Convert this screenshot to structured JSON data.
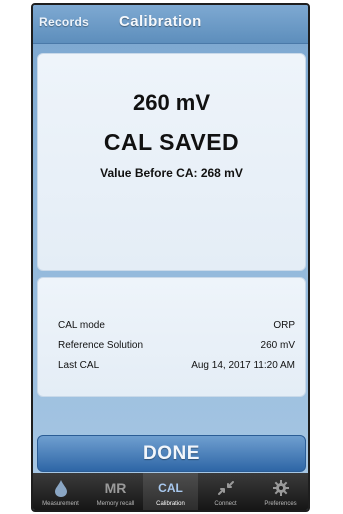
{
  "header": {
    "back_label": "Records",
    "title": "Calibration"
  },
  "result": {
    "value": "260 mV",
    "status": "CAL SAVED",
    "before": "Value Before CA: 268 mV"
  },
  "info": {
    "rows": [
      {
        "key": "CAL mode",
        "value": "ORP"
      },
      {
        "key": "Reference Solution",
        "value": "260 mV"
      },
      {
        "key": "Last CAL",
        "value": "Aug 14, 2017 11:20 AM"
      }
    ]
  },
  "done_label": "DONE",
  "tabs": [
    {
      "label": "Measurement",
      "icon": "drop-icon"
    },
    {
      "label": "Memory recall",
      "icon_text": "MR"
    },
    {
      "label": "Calibration",
      "icon_text": "CAL",
      "active": true
    },
    {
      "label": "Connect",
      "icon": "connect-arrows-icon"
    },
    {
      "label": "Preferences",
      "icon": "gear-icon"
    }
  ],
  "colors": {
    "header": "#5d8ebc",
    "done_button": "#2e66a6",
    "active_tab_text": "#a8c8ee"
  }
}
